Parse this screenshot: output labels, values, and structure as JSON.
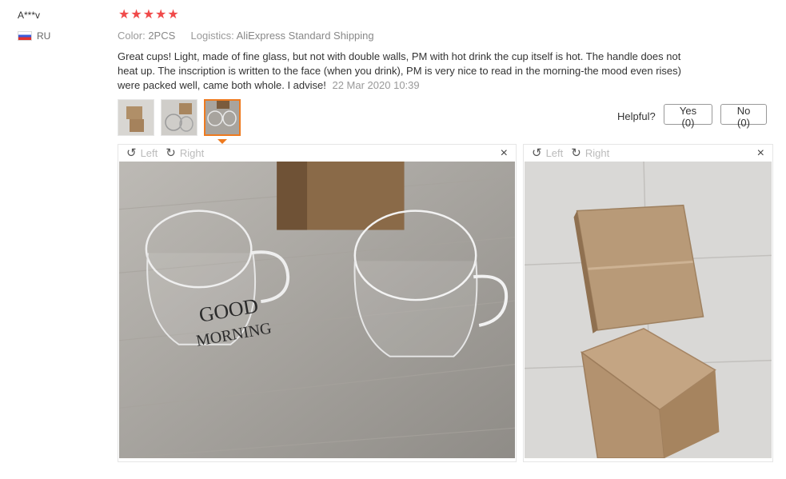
{
  "user": {
    "name": "A***v",
    "country": "RU",
    "flag_icon": "russia-flag-icon"
  },
  "rating": {
    "stars": 5,
    "max": 5,
    "color": "#f04a4a"
  },
  "meta": {
    "color_label": "Color:",
    "color_value": "2PCS",
    "logistics_label": "Logistics:",
    "logistics_value": "AliExpress Standard Shipping"
  },
  "review": {
    "text": "Great cups! Light, made of fine glass, but not with double walls, PM with hot drink the cup itself is hot. The handle does not heat up. The inscription is written to the face (when you drink), PM is very nice to read in the morning-the mood even rises) were packed well, came both whole. I advise!",
    "date": "22 Mar 2020 10:39"
  },
  "helpful": {
    "label": "Helpful?",
    "yes_label": "Yes (0)",
    "no_label": "No (0)"
  },
  "thumbnails": [
    {
      "name": "thumbnail-box",
      "active": false
    },
    {
      "name": "thumbnail-cups-box",
      "active": false
    },
    {
      "name": "thumbnail-glass-cups",
      "active": true
    }
  ],
  "viewers": [
    {
      "rotate_left": "Left",
      "rotate_right": "Right",
      "close": "×",
      "image_desc": "glass-cups-photo"
    },
    {
      "rotate_left": "Left",
      "rotate_right": "Right",
      "close": "×",
      "image_desc": "cardboard-boxes-photo"
    }
  ],
  "mug_text": {
    "line1": "GOOD",
    "line2": "MORNING"
  },
  "colors": {
    "accent": "#ee7a1f",
    "star": "#f04a4a",
    "muted": "#999999"
  }
}
